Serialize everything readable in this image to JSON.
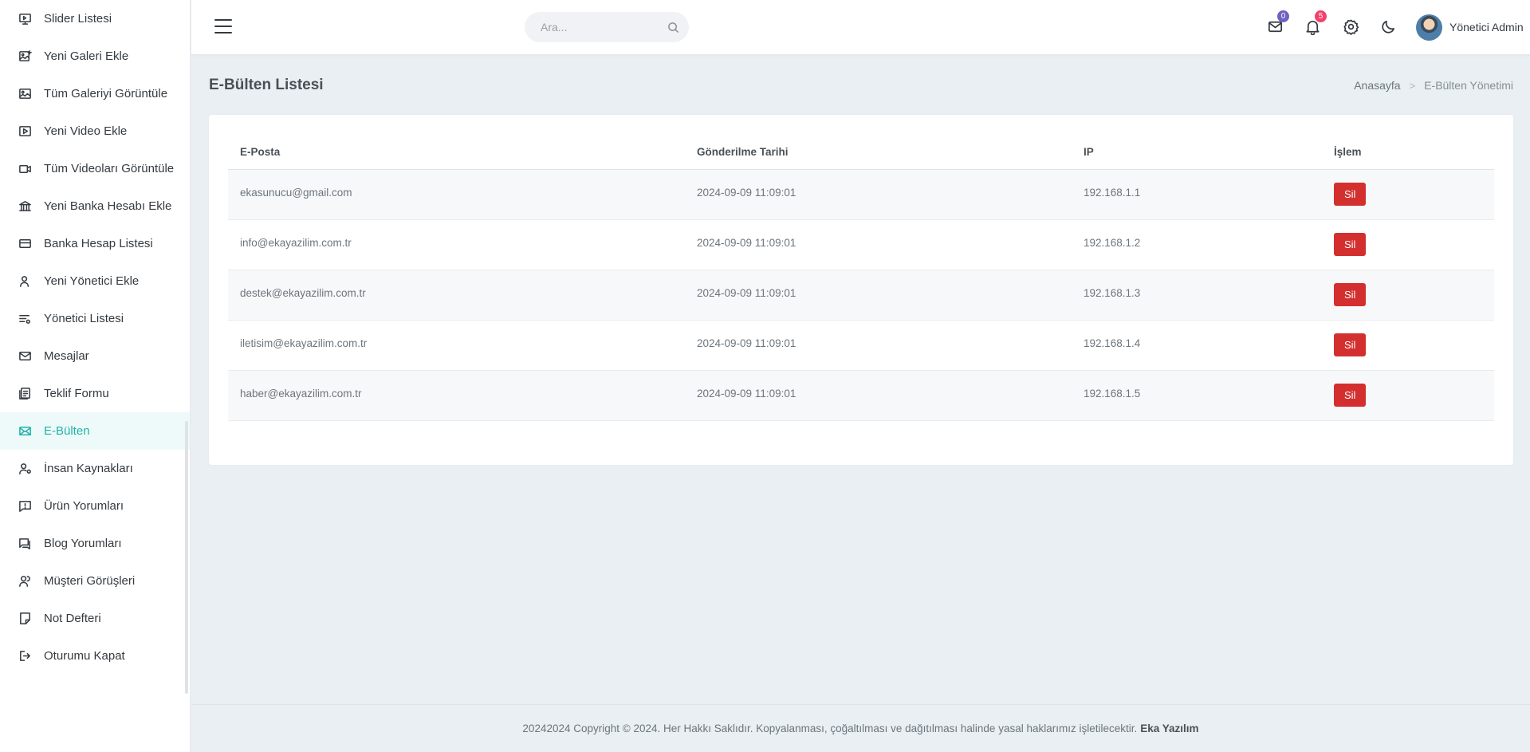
{
  "sidebar": {
    "items": [
      {
        "label": "Slider Listesi",
        "icon": "slider-icon"
      },
      {
        "label": "Yeni Galeri Ekle",
        "icon": "gallery-add-icon"
      },
      {
        "label": "Tüm Galeriyi Görüntüle",
        "icon": "image-icon"
      },
      {
        "label": "Yeni Video Ekle",
        "icon": "video-add-icon"
      },
      {
        "label": "Tüm Videoları Görüntüle",
        "icon": "video-icon"
      },
      {
        "label": "Yeni Banka Hesabı Ekle",
        "icon": "bank-icon"
      },
      {
        "label": "Banka Hesap Listesi",
        "icon": "card-icon"
      },
      {
        "label": "Yeni Yönetici Ekle",
        "icon": "user-add-icon"
      },
      {
        "label": "Yönetici Listesi",
        "icon": "list-settings-icon"
      },
      {
        "label": "Mesajlar",
        "icon": "mail-icon"
      },
      {
        "label": "Teklif Formu",
        "icon": "form-icon"
      },
      {
        "label": "E-Bülten",
        "icon": "newsletter-icon",
        "active": true
      },
      {
        "label": "İnsan Kaynakları",
        "icon": "hr-icon"
      },
      {
        "label": "Ürün Yorumları",
        "icon": "comment-icon"
      },
      {
        "label": "Blog Yorumları",
        "icon": "comments-icon"
      },
      {
        "label": "Müşteri Görüşleri",
        "icon": "customers-icon"
      },
      {
        "label": "Not Defteri",
        "icon": "note-icon"
      },
      {
        "label": "Oturumu Kapat",
        "icon": "logout-icon"
      }
    ]
  },
  "topbar": {
    "search_placeholder": "Ara...",
    "mail_count": "0",
    "notification_count": "5",
    "user_name": "Yönetici Admin"
  },
  "page": {
    "title": "E-Bülten Listesi",
    "breadcrumb_home": "Anasayfa",
    "breadcrumb_current": "E-Bülten Yönetimi"
  },
  "table": {
    "headers": {
      "email": "E-Posta",
      "date": "Gönderilme Tarihi",
      "ip": "IP",
      "action": "İşlem"
    },
    "rows": [
      {
        "email": "ekasunucu@gmail.com",
        "date": "2024-09-09 11:09:01",
        "ip": "192.168.1.1",
        "action": "Sil"
      },
      {
        "email": "info@ekayazilim.com.tr",
        "date": "2024-09-09 11:09:01",
        "ip": "192.168.1.2",
        "action": "Sil"
      },
      {
        "email": "destek@ekayazilim.com.tr",
        "date": "2024-09-09 11:09:01",
        "ip": "192.168.1.3",
        "action": "Sil"
      },
      {
        "email": "iletisim@ekayazilim.com.tr",
        "date": "2024-09-09 11:09:01",
        "ip": "192.168.1.4",
        "action": "Sil"
      },
      {
        "email": "haber@ekayazilim.com.tr",
        "date": "2024-09-09 11:09:01",
        "ip": "192.168.1.5",
        "action": "Sil"
      }
    ]
  },
  "footer": {
    "text": "20242024 Copyright © 2024. Her Hakkı Saklıdır. Kopyalanması, çoğaltılması ve dağıtılması halinde yasal haklarımız işletilecektir.",
    "brand": "Eka Yazılım"
  },
  "colors": {
    "accent": "#20b2aa",
    "danger": "#d32f2f",
    "background": "#e9eff2"
  }
}
